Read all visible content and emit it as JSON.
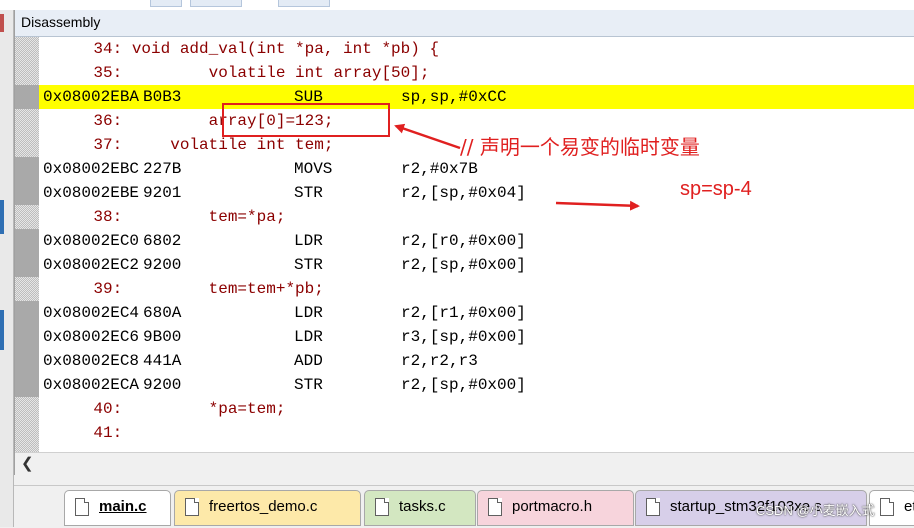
{
  "window": {
    "title": "Disassembly"
  },
  "lines": [
    {
      "kind": "src",
      "text": "    34: void add_val(int *pa, int *pb) {"
    },
    {
      "kind": "src",
      "text": "    35:         volatile int array[50];"
    },
    {
      "kind": "asm",
      "current": true,
      "addr": "0x08002EBA",
      "opcode": "B0B3",
      "mnemonic": "SUB",
      "operands": "sp,sp,#0xCC"
    },
    {
      "kind": "src",
      "text": "    36:         array[0]=123;"
    },
    {
      "kind": "src",
      "text": "    37:     volatile int tem;"
    },
    {
      "kind": "asm",
      "addr": "0x08002EBC",
      "opcode": "227B",
      "mnemonic": "MOVS",
      "operands": "r2,#0x7B"
    },
    {
      "kind": "asm",
      "addr": "0x08002EBE",
      "opcode": "9201",
      "mnemonic": "STR",
      "operands": "r2,[sp,#0x04]"
    },
    {
      "kind": "src",
      "text": "    38:         tem=*pa;"
    },
    {
      "kind": "asm",
      "addr": "0x08002EC0",
      "opcode": "6802",
      "mnemonic": "LDR",
      "operands": "r2,[r0,#0x00]"
    },
    {
      "kind": "asm",
      "addr": "0x08002EC2",
      "opcode": "9200",
      "mnemonic": "STR",
      "operands": "r2,[sp,#0x00]"
    },
    {
      "kind": "src",
      "text": "    39:         tem=tem+*pb;"
    },
    {
      "kind": "asm",
      "addr": "0x08002EC4",
      "opcode": "680A",
      "mnemonic": "LDR",
      "operands": "r2,[r1,#0x00]"
    },
    {
      "kind": "asm",
      "addr": "0x08002EC6",
      "opcode": "9B00",
      "mnemonic": "LDR",
      "operands": "r3,[sp,#0x00]"
    },
    {
      "kind": "asm",
      "addr": "0x08002EC8",
      "opcode": "441A",
      "mnemonic": "ADD",
      "operands": "r2,r2,r3"
    },
    {
      "kind": "asm",
      "addr": "0x08002ECA",
      "opcode": "9200",
      "mnemonic": "STR",
      "operands": "r2,[sp,#0x00]"
    },
    {
      "kind": "src",
      "text": "    40:         *pa=tem;"
    },
    {
      "kind": "src",
      "text": "    41:"
    }
  ],
  "annotations": {
    "volatile_note": "// 声明一个易变的临时变量",
    "sp_note": "sp=sp-4",
    "color": "#e02020"
  },
  "tabs": [
    {
      "label": "main.c",
      "active": true,
      "color": "#ffffff",
      "icon": "c-file-icon"
    },
    {
      "label": "freertos_demo.c",
      "color": "#fde9a9",
      "icon": "c-file-icon"
    },
    {
      "label": "tasks.c",
      "color": "#d3e7c1",
      "icon": "c-file-icon"
    },
    {
      "label": "portmacro.h",
      "color": "#f7d4dc",
      "icon": "h-file-icon"
    },
    {
      "label": "startup_stm32f103xe.s",
      "color": "#d7cfe9",
      "icon": "s-file-icon"
    },
    {
      "label": "et",
      "color": "#ffffff",
      "icon": "file-icon"
    }
  ],
  "watermark": "CSDN @小麦嵌入式",
  "scroll_icon": "chevron-left-icon"
}
